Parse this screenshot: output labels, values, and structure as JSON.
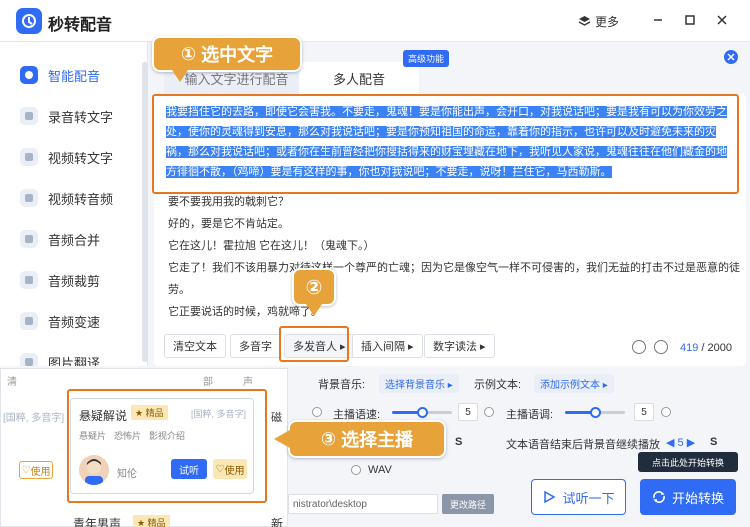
{
  "app": {
    "title": "秒转配音",
    "more": "更多"
  },
  "sidebar": {
    "items": [
      {
        "label": "智能配音",
        "active": true
      },
      {
        "label": "录音转文字"
      },
      {
        "label": "视频转文字"
      },
      {
        "label": "视频转音频"
      },
      {
        "label": "音频合并"
      },
      {
        "label": "音频裁剪"
      },
      {
        "label": "音频变速"
      },
      {
        "label": "图片翻译"
      }
    ]
  },
  "tabs": [
    {
      "label": "输入文字进行配音"
    },
    {
      "label": "多人配音",
      "active": true
    }
  ],
  "badge_advanced": "高级功能",
  "editor": {
    "selected_text": "我要挡住它的去路，即使它会害我。不要走，鬼魂！要是你能出声，会开口，对我说话吧；要是我有可以为你效劳之处，使你的灵魂得到安息，那么对我说话吧；要是你预知祖国的命运，靠着你的指示，也许可以及时避免未来的灾祸，那么对我说话吧；或者你在生前曾经把你搜括得来的财宝埋藏在地下，我听见人家说，鬼魂往往在他们藏金的地方徘徊不散，（鸡啼）要是有这样的事，你也对我说吧；不要走，说呀！拦住它，马西勒斯。",
    "lines": [
      "要不要我用我的戟刺它？",
      "好的，要是它不肯站定。",
      "它在这儿！霍拉旭 它在这儿！（鬼魂下。）",
      "它走了！我们不该用暴力对待这样一个尊严的亡魂；因为它是像空气一样不可侵害的，我们无益的打击不过是恶意的徒",
      "劳。",
      "它正要说话的时候，鸡就啼了。"
    ],
    "buttons": [
      "清空文本",
      "多音字",
      "多发音人",
      "插入间隔",
      "数字读法"
    ],
    "count": "419",
    "max": "/ 2000"
  },
  "steps": {
    "s1": {
      "num": "①",
      "label": "选中文字"
    },
    "s2": {
      "num": "②"
    },
    "s3": {
      "num": "③",
      "label": "选择主播"
    }
  },
  "settings": {
    "bg_music_label": "背景音乐:",
    "bg_music_btn": "选择背景音乐",
    "sample_label": "示例文本:",
    "sample_btn": "添加示例文本",
    "rate_label": "主播语速:",
    "rate_value": 5,
    "pitch_label": "主播语调:",
    "pitch_value": 5,
    "bg_continue": "文本语音结束后背景音继续播放",
    "bg_continue_value": "5",
    "s_unit": "S",
    "format_wav": "WAV",
    "path": "nistrator\\desktop",
    "change_path": "更改路径"
  },
  "voice_panel": {
    "heads": [
      "清",
      "部",
      "声"
    ],
    "ghost": [
      "[国粹, 多音字]",
      "[国粹, 多音字]",
      "磁"
    ],
    "card": {
      "name": "悬疑解说",
      "badge": "★ 精品",
      "tags": [
        "悬疑片",
        "恐怖片",
        "影视介绍"
      ],
      "tag_extra": "[国粹, 多音字]",
      "person": "知伦",
      "listen": "试听",
      "use": "使用"
    },
    "left_use": "使用",
    "bottom_left": "",
    "bottom_mid_name": "青年男声",
    "bottom_mid_badge": "★ 精品",
    "bottom_right": "新"
  },
  "actions": {
    "try": "试听一下",
    "start": "开始转换",
    "tooltip": "点击此处开始转换"
  },
  "colors": {
    "accent": "#2f6bf5",
    "callout": "#e87722",
    "step": "#e8a23a"
  }
}
